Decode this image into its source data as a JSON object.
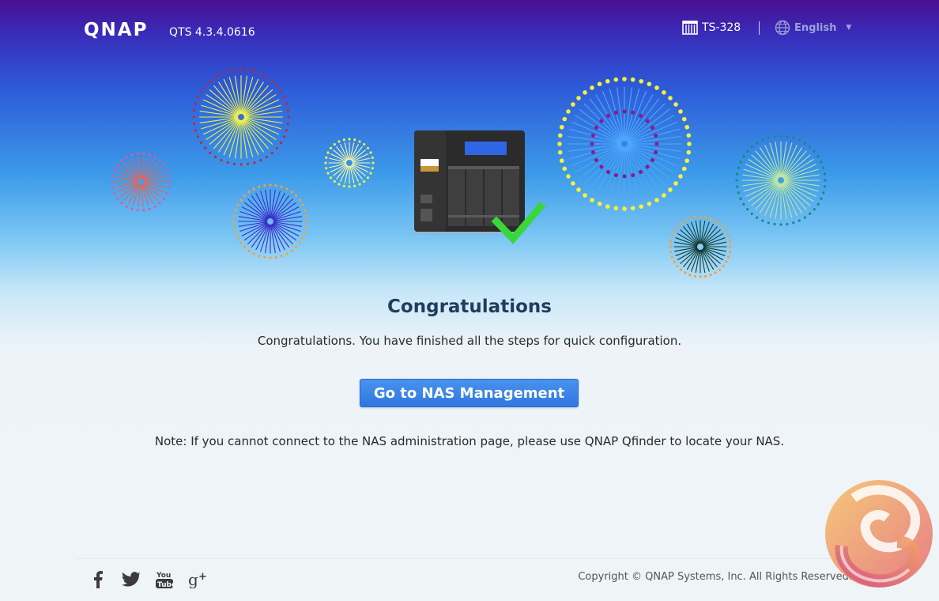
{
  "header": {
    "logo": "QNAP",
    "version": "QTS 4.3.4.0616",
    "model_icon": "nas-device-icon",
    "model": "TS-328",
    "language_icon": "globe-icon",
    "language": "English",
    "language_caret_icon": "caret-down-icon"
  },
  "main": {
    "title": "Congratulations",
    "subtitle": "Congratulations. You have finished all the steps for quick configuration.",
    "button_label": "Go to NAS Management",
    "note": "Note: If you cannot connect to the NAS administration page, please use QNAP Qfinder to locate your NAS."
  },
  "footer": {
    "social": [
      {
        "icon": "facebook-icon"
      },
      {
        "icon": "twitter-icon"
      },
      {
        "icon": "youtube-icon"
      },
      {
        "icon": "google-plus-icon"
      }
    ],
    "copyright": "Copyright © QNAP Systems, Inc. All Rights Reserved."
  },
  "colors": {
    "header_top": "#4a0f8f",
    "sky_mid": "#3c9ae9",
    "button": "#3580e6",
    "title": "#1f3d5c",
    "check": "#3bd63b"
  }
}
